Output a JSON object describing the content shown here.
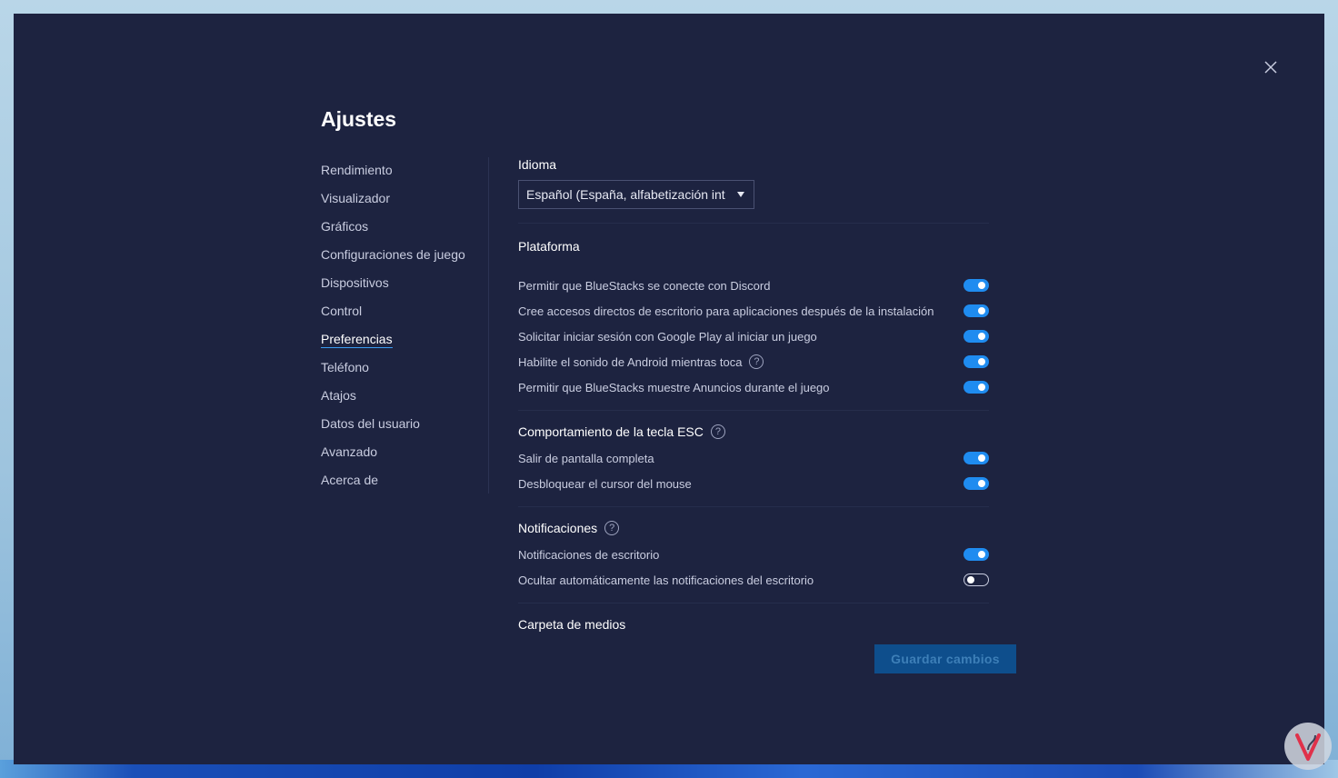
{
  "dialog": {
    "title": "Ajustes",
    "close_icon": "close-icon"
  },
  "sidebar": {
    "items": [
      {
        "label": "Rendimiento",
        "active": false
      },
      {
        "label": "Visualizador",
        "active": false
      },
      {
        "label": "Gráficos",
        "active": false
      },
      {
        "label": "Configuraciones de juego",
        "active": false
      },
      {
        "label": "Dispositivos",
        "active": false
      },
      {
        "label": "Control",
        "active": false
      },
      {
        "label": "Preferencias",
        "active": true
      },
      {
        "label": "Teléfono",
        "active": false
      },
      {
        "label": "Atajos",
        "active": false
      },
      {
        "label": "Datos del usuario",
        "active": false
      },
      {
        "label": "Avanzado",
        "active": false
      },
      {
        "label": "Acerca de",
        "active": false
      }
    ]
  },
  "language": {
    "title": "Idioma",
    "selected": "Español (España, alfabetización int"
  },
  "platform": {
    "title": "Plataforma",
    "options": [
      {
        "label": "Permitir que BlueStacks se conecte con Discord",
        "on": true,
        "help": false
      },
      {
        "label": "Cree accesos directos de escritorio para aplicaciones después de la instalación",
        "on": true,
        "help": false
      },
      {
        "label": "Solicitar iniciar sesión con Google Play al iniciar un juego",
        "on": true,
        "help": false
      },
      {
        "label": "Habilite el sonido de Android mientras toca",
        "on": true,
        "help": true
      },
      {
        "label": "Permitir que BlueStacks muestre Anuncios durante el juego",
        "on": true,
        "help": false
      }
    ]
  },
  "esc": {
    "title": "Comportamiento de la tecla ESC",
    "options": [
      {
        "label": "Salir de pantalla completa",
        "on": true
      },
      {
        "label": "Desbloquear el cursor del mouse",
        "on": true
      }
    ]
  },
  "notifications": {
    "title": "Notificaciones",
    "options": [
      {
        "label": "Notificaciones de escritorio",
        "on": true
      },
      {
        "label": "Ocultar automáticamente las notificaciones del escritorio",
        "on": false
      }
    ]
  },
  "media": {
    "title": "Carpeta de medios"
  },
  "footer": {
    "save_label": "Guardar cambios"
  },
  "colors": {
    "background": "#1d2340",
    "accent": "#1f8cf0",
    "save_button": "#0e4e8c"
  }
}
